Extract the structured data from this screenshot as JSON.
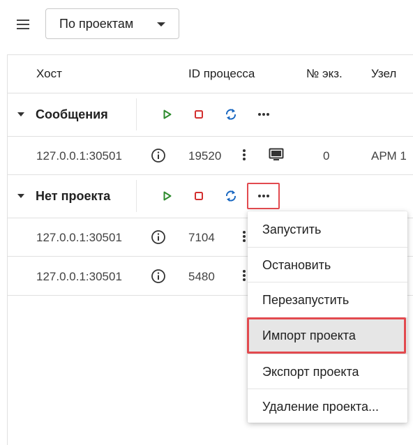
{
  "toolbar": {
    "menu_icon": "hamburger-menu-icon",
    "group_select": {
      "value": "По проектам",
      "caret_icon": "caret-down-icon"
    }
  },
  "table": {
    "columns": {
      "host": "Хост",
      "pid": "ID процесса",
      "instance": "№ экз.",
      "node": "Узел"
    },
    "groups": [
      {
        "title": "Сообщения",
        "actions": [
          "play-icon",
          "stop-icon",
          "restart-icon",
          "more-horizontal-icon"
        ],
        "rows": [
          {
            "host": "127.0.0.1:30501",
            "pid": "19520",
            "instance": "0",
            "node": "АРМ 1",
            "icons": [
              "info-icon",
              "more-vertical-icon",
              "monitor-icon"
            ]
          }
        ]
      },
      {
        "title": "Нет проекта",
        "actions": [
          "play-icon",
          "stop-icon",
          "restart-icon",
          "more-horizontal-icon"
        ],
        "rows": [
          {
            "host": "127.0.0.1:30501",
            "pid": "7104",
            "icons": [
              "info-icon",
              "more-vertical-icon"
            ]
          },
          {
            "host": "127.0.0.1:30501",
            "pid": "5480",
            "icons": [
              "info-icon",
              "more-vertical-icon"
            ]
          }
        ]
      }
    ]
  },
  "context_menu": {
    "items": [
      {
        "label": "Запустить"
      },
      {
        "label": "Остановить"
      },
      {
        "label": "Перезапустить"
      },
      {
        "label": "Импорт проекта",
        "highlighted": true
      },
      {
        "label": "Экспорт проекта"
      },
      {
        "label": "Удаление проекта..."
      }
    ]
  },
  "colors": {
    "play": "#2e8b2e",
    "stop": "#d32f2f",
    "restart": "#1565c0",
    "highlight_border": "#e24a4f"
  }
}
